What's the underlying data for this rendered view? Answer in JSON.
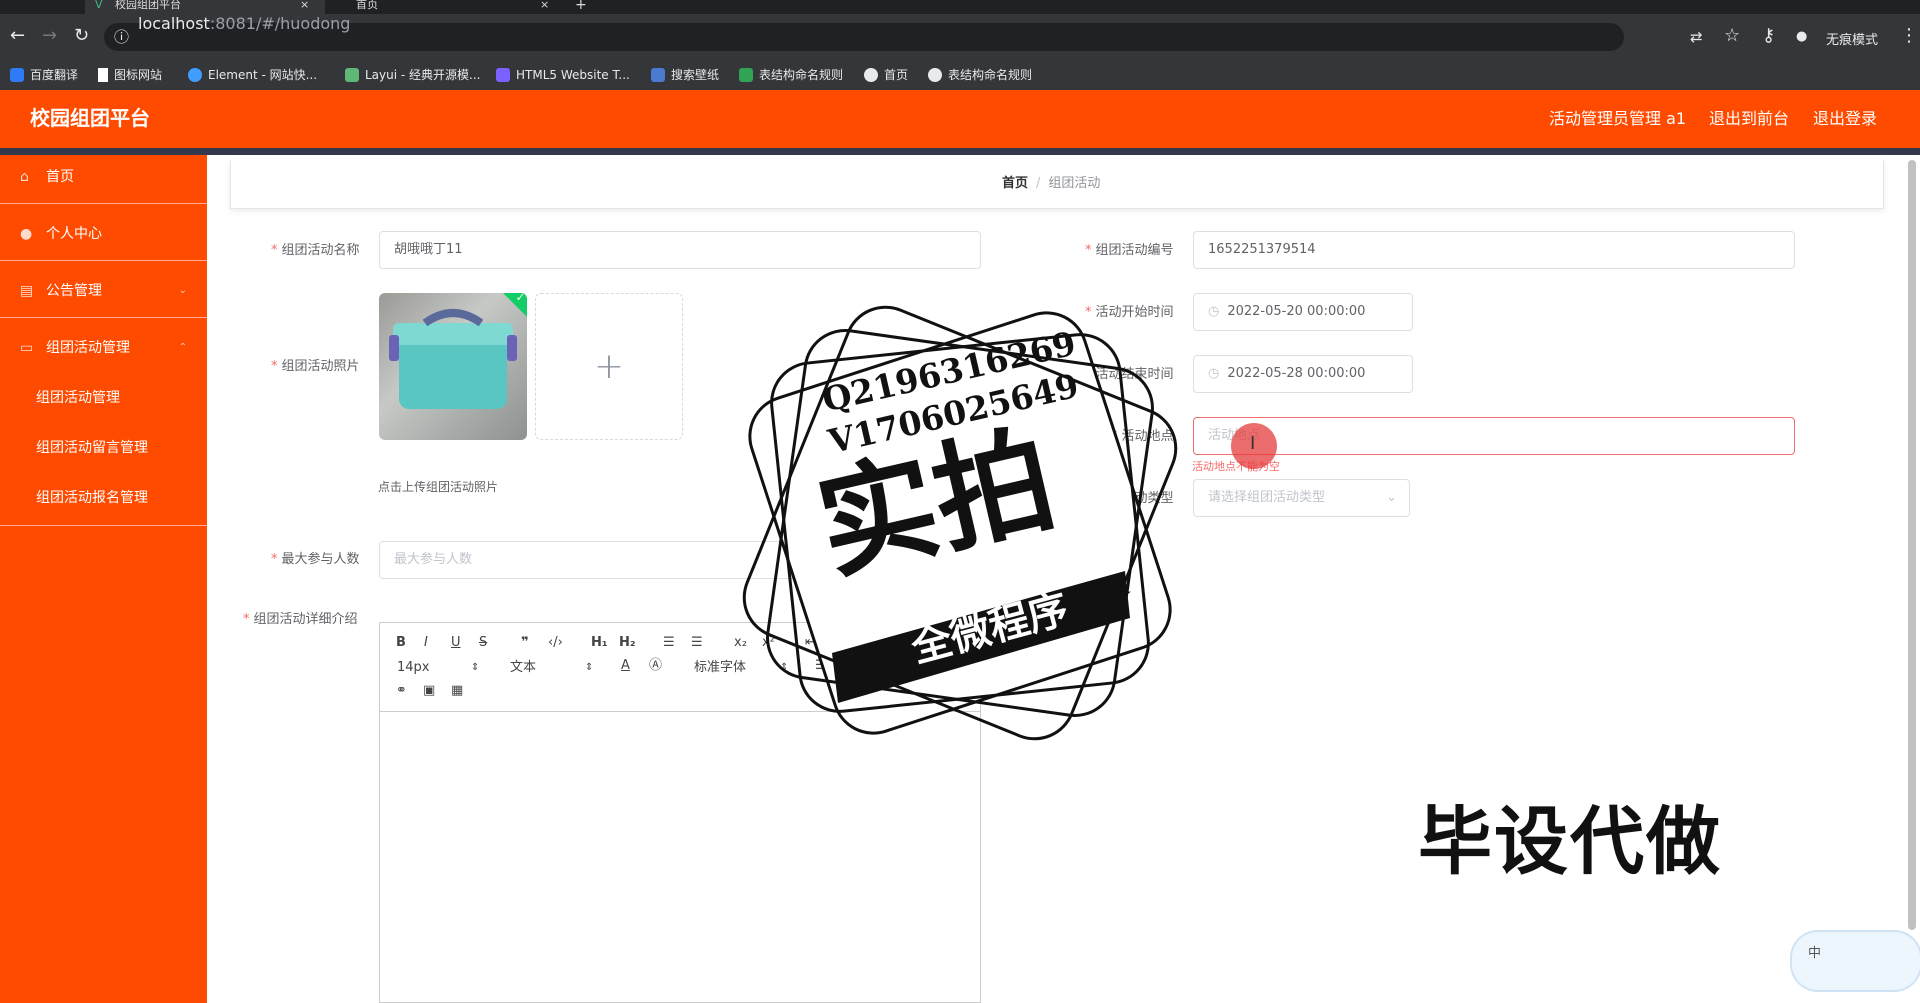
{
  "browser": {
    "tabs": [
      {
        "title": "校园组团平台",
        "active": true
      },
      {
        "title": "首页",
        "active": false
      }
    ],
    "url_host": "localhost",
    "url_rest": ":8081/#/huodong",
    "incognito_label": "无痕模式",
    "bookmarks": [
      {
        "label": "百度翻译",
        "color": "#2f7bf5"
      },
      {
        "label": "图标网站",
        "color": "#ffffff"
      },
      {
        "label": "Element - 网站快...",
        "color": "#409eff"
      },
      {
        "label": "Layui - 经典开源模...",
        "color": "#5fb878"
      },
      {
        "label": "HTML5 Website T...",
        "color": "#7b61ff"
      },
      {
        "label": "搜索壁纸",
        "color": "#4a7bd0"
      },
      {
        "label": "表结构命名规则",
        "color": "#31a354"
      },
      {
        "label": "首页",
        "color": "#e8eaed"
      },
      {
        "label": "表结构命名规则",
        "color": "#e8eaed"
      }
    ]
  },
  "header": {
    "brand": "校园组团平台",
    "user": "活动管理员管理 a1",
    "front": "退出到前台",
    "logout": "退出登录",
    "bg_color": "#ff4b00"
  },
  "sidebar": {
    "items": [
      {
        "label": "首页",
        "icon": "home-icon"
      },
      {
        "label": "个人中心",
        "icon": "user-icon"
      },
      {
        "label": "公告管理",
        "icon": "notice-icon"
      },
      {
        "label": "组团活动管理",
        "icon": "group-icon"
      }
    ],
    "sub_items": [
      "组团活动管理",
      "组团活动留言管理",
      "组团活动报名管理"
    ]
  },
  "breadcrumb": {
    "home": "首页",
    "separator": "/",
    "current": "组团活动"
  },
  "form": {
    "name_label": "组团活动名称",
    "name_value": "胡哦哦丁11",
    "photo_label": "组团活动照片",
    "photo_tip": "点击上传组团活动照片",
    "max_label": "最大参与人数",
    "max_placeholder": "最大参与人数",
    "detail_label": "组团活动详细介绍",
    "code_label": "组团活动编号",
    "code_value": "1652251379514",
    "start_label": "活动开始时间",
    "start_value": "2022-05-20 00:00:00",
    "end_label": "活动结束时间",
    "end_value": "2022-05-28 00:00:00",
    "place_label": "活动地点",
    "place_placeholder": "活动地点",
    "place_error": "活动地点不能为空",
    "type_label": "组团活动类型",
    "type_placeholder": "请选择组团活动类型"
  },
  "editor": {
    "font_size": "14px",
    "text_format": "文本",
    "font_family": "标准字体"
  },
  "watermark": {
    "qq": "Q2196316269",
    "vx": "V1706025649",
    "big": "实拍",
    "banner": "全微程序",
    "side": "毕设代做"
  },
  "ime": {
    "label": "中"
  }
}
